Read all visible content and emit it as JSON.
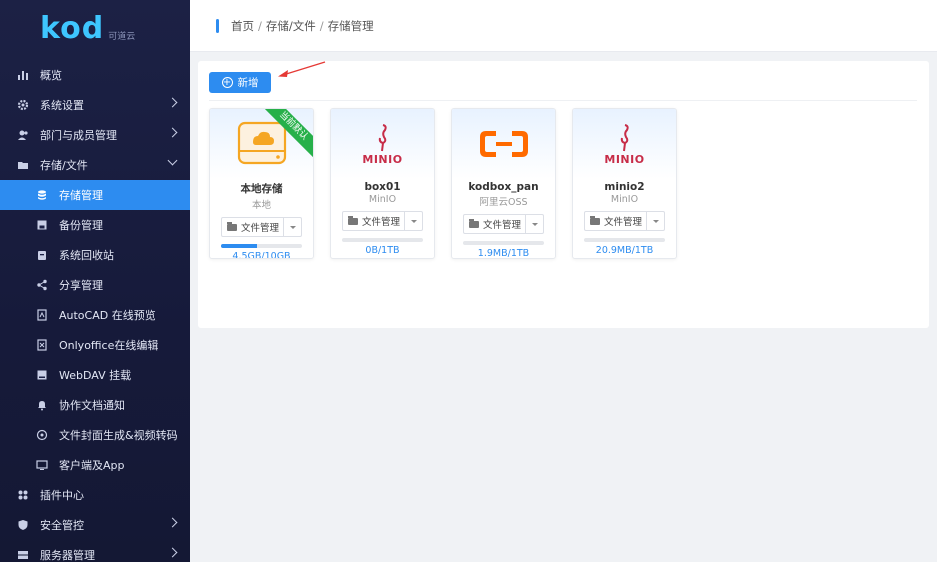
{
  "brand": {
    "logo": "kod",
    "sub": "可道云"
  },
  "sidebar": {
    "items": [
      {
        "label": "概览",
        "icon": "bar-chart-icon"
      },
      {
        "label": "系统设置",
        "icon": "gear-icon"
      },
      {
        "label": "部门与成员管理",
        "icon": "users-icon"
      },
      {
        "label": "存储/文件",
        "icon": "folder-icon"
      },
      {
        "label": "存储管理",
        "icon": "database-icon"
      },
      {
        "label": "备份管理",
        "icon": "save-icon"
      },
      {
        "label": "系统回收站",
        "icon": "trash-icon"
      },
      {
        "label": "分享管理",
        "icon": "share-icon"
      },
      {
        "label": "AutoCAD 在线预览",
        "icon": "cad-icon"
      },
      {
        "label": "Onlyoffice在线编辑",
        "icon": "office-icon"
      },
      {
        "label": "WebDAV 挂载",
        "icon": "drive-icon"
      },
      {
        "label": "协作文档通知",
        "icon": "bell-icon"
      },
      {
        "label": "文件封面生成&视频转码",
        "icon": "video-icon"
      },
      {
        "label": "客户端及App",
        "icon": "monitor-icon"
      },
      {
        "label": "插件中心",
        "icon": "plugin-icon"
      },
      {
        "label": "安全管控",
        "icon": "shield-icon"
      },
      {
        "label": "服务器管理",
        "icon": "server-icon"
      }
    ]
  },
  "breadcrumb": {
    "home": "首页",
    "level1": "存储/文件",
    "level2": "存储管理",
    "sep": "/"
  },
  "toolbar": {
    "add_label": "新增"
  },
  "storages": [
    {
      "name": "本地存储",
      "type": "本地",
      "usage": "4.5GB/10GB",
      "progress": 0.45,
      "default_badge": "当前默认",
      "manage_label": "文件管理"
    },
    {
      "name": "box01",
      "type": "MinIO",
      "usage": "0B/1TB",
      "progress": 0.0,
      "manage_label": "文件管理"
    },
    {
      "name": "kodbox_pan",
      "type": "阿里云OSS",
      "usage": "1.9MB/1TB",
      "progress": 0.0,
      "manage_label": "文件管理"
    },
    {
      "name": "minio2",
      "type": "MinIO",
      "usage": "20.9MB/1TB",
      "progress": 0.0,
      "manage_label": "文件管理"
    }
  ],
  "logos": {
    "minio": "MINIO"
  },
  "colors": {
    "accent": "#2d8cf0",
    "sidebar_bg": "#1c2145",
    "badge": "#27b04a",
    "minio": "#c72c48",
    "aliyun": "#ff6a00",
    "local": "#f5a623"
  }
}
